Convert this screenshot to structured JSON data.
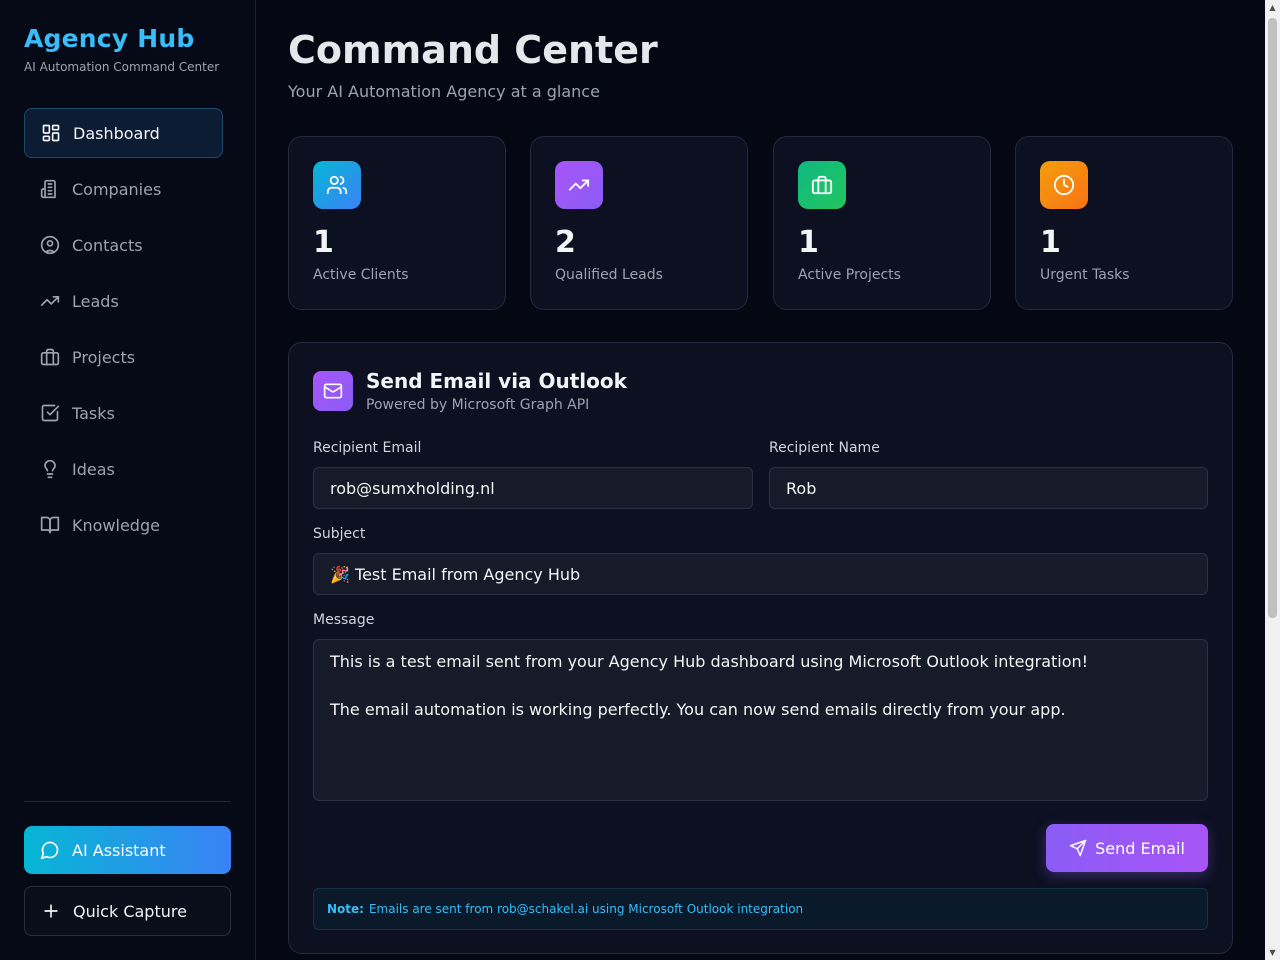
{
  "brand": {
    "title": "Agency Hub",
    "subtitle": "AI Automation Command Center"
  },
  "sidebar": {
    "items": [
      {
        "label": "Dashboard",
        "icon": "dashboard-icon",
        "active": true
      },
      {
        "label": "Companies",
        "icon": "building-icon"
      },
      {
        "label": "Contacts",
        "icon": "user-circle-icon"
      },
      {
        "label": "Leads",
        "icon": "trending-up-icon"
      },
      {
        "label": "Projects",
        "icon": "briefcase-icon"
      },
      {
        "label": "Tasks",
        "icon": "checkbox-icon"
      },
      {
        "label": "Ideas",
        "icon": "lightbulb-icon"
      },
      {
        "label": "Knowledge",
        "icon": "book-icon"
      }
    ],
    "ai_assistant_label": "AI Assistant",
    "quick_capture_label": "Quick Capture"
  },
  "header": {
    "title": "Command Center",
    "subtitle": "Your AI Automation Agency at a glance"
  },
  "stats": [
    {
      "value": "1",
      "label": "Active Clients",
      "icon": "users-icon",
      "color": "#0ea5e9"
    },
    {
      "value": "2",
      "label": "Qualified Leads",
      "icon": "trending-up-icon",
      "color": "#a855f7"
    },
    {
      "value": "1",
      "label": "Active Projects",
      "icon": "briefcase-icon",
      "color": "#10b981"
    },
    {
      "value": "1",
      "label": "Urgent Tasks",
      "icon": "clock-icon",
      "color": "#f59e0b"
    }
  ],
  "email": {
    "title": "Send Email via Outlook",
    "subtitle": "Powered by Microsoft Graph API",
    "recipient_email_label": "Recipient Email",
    "recipient_email_value": "rob@sumxholding.nl",
    "recipient_name_label": "Recipient Name",
    "recipient_name_value": "Rob",
    "subject_label": "Subject",
    "subject_value": "🎉 Test Email from Agency Hub",
    "message_label": "Message",
    "message_value": "This is a test email sent from your Agency Hub dashboard using Microsoft Outlook integration!\n\nThe email automation is working perfectly. You can now send emails directly from your app.",
    "send_label": "Send Email",
    "note_label": "Note:",
    "note_text": "Emails are sent from rob@schakel.ai using Microsoft Outlook integration"
  },
  "colors": {
    "accent": "#38bdf8",
    "purple": "#8b5cf6",
    "background": "#050812"
  }
}
